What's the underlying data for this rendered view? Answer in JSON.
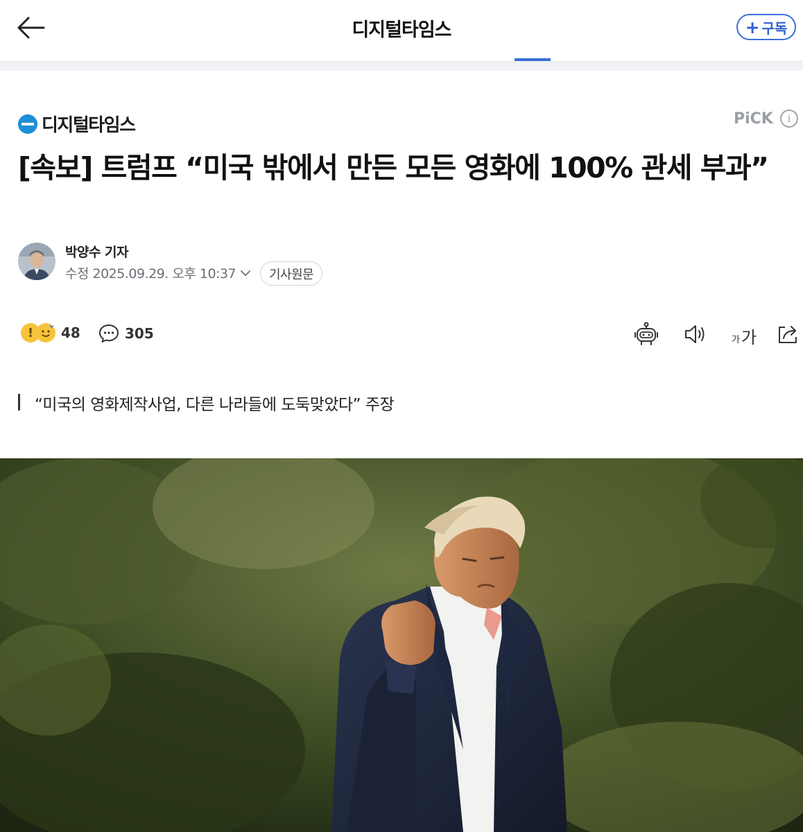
{
  "header": {
    "title": "디지털타임스",
    "subscribe_label": "구독"
  },
  "press": {
    "name": "디지털타임스",
    "logo_text": "디지털타임스",
    "pick_label": "PiCK"
  },
  "article": {
    "headline": "[속보] 트럼프 “미국 밖에서 만든 모든 영화에 100% 관세 부과”",
    "reporter": "박양수 기자",
    "modified": "수정 2025.09.29. 오후 10:37",
    "original_button": "기사원문",
    "subtitle": "“미국의 영화제작사업, 다른 나라들에 도둑맞았다” 주장"
  },
  "actions": {
    "reaction_count": "48",
    "comment_count": "305",
    "font_small": "가",
    "font_big": "가"
  },
  "icons": [
    "back-arrow-icon",
    "info-icon",
    "robot-summary-icon",
    "speaker-icon",
    "share-icon",
    "comment-bubble-icon"
  ],
  "colors": {
    "accent": "#3b6fd8",
    "press_logo": "#1f8fd6",
    "reaction": "#f7c33b"
  }
}
